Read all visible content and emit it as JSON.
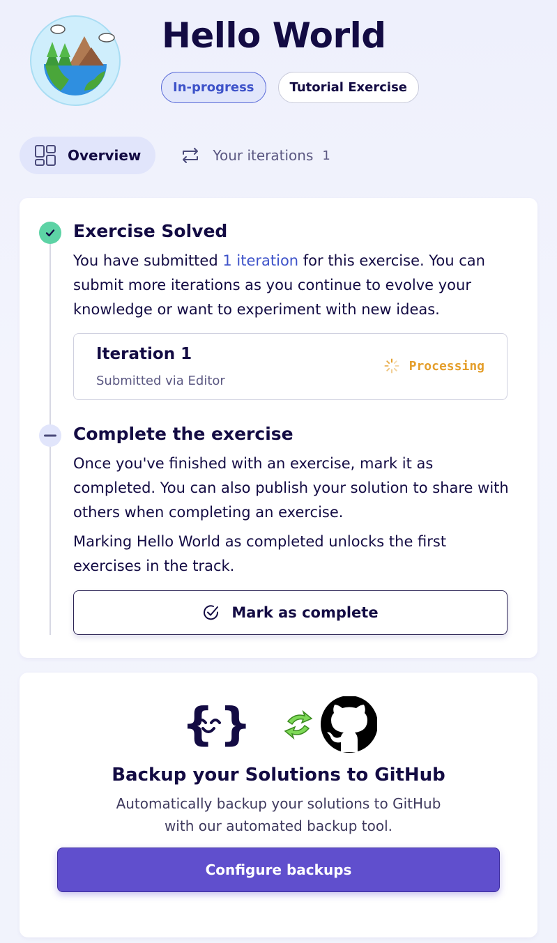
{
  "exercise": {
    "title": "Hello World",
    "icon": "globe-with-trees-icon",
    "tags": {
      "status": "In-progress",
      "type": "Tutorial Exercise"
    }
  },
  "tabs": [
    {
      "label": "Overview",
      "icon": "layout-grid-icon",
      "active": true
    },
    {
      "label": "Your iterations",
      "icon": "iterations-icon",
      "count": "1",
      "active": false
    }
  ],
  "steps": {
    "solved": {
      "title": "Exercise Solved",
      "text_before": "You have submitted ",
      "link": "1 iteration",
      "text_after": " for this exercise. You can submit more iterations as you continue to evolve your knowledge or want to experiment with new ideas."
    },
    "iteration": {
      "title": "Iteration 1",
      "subtitle": "Submitted via Editor",
      "status": "Processing"
    },
    "complete": {
      "title": "Complete the exercise",
      "text1": "Once you've finished with an exercise, mark it as completed. You can also publish your solution to share with others when completing an exercise.",
      "text2": "Marking Hello World as completed unlocks the first exercises in the track.",
      "button": "Mark as complete"
    }
  },
  "backup": {
    "title": "Backup your Solutions to GitHub",
    "text": "Automatically backup your solutions to GitHub with our automated backup tool.",
    "button": "Configure backups"
  },
  "colors": {
    "accent": "#604fcd",
    "success": "#5dd3a5",
    "processing": "#e49e2b",
    "link": "#3d52c9"
  }
}
